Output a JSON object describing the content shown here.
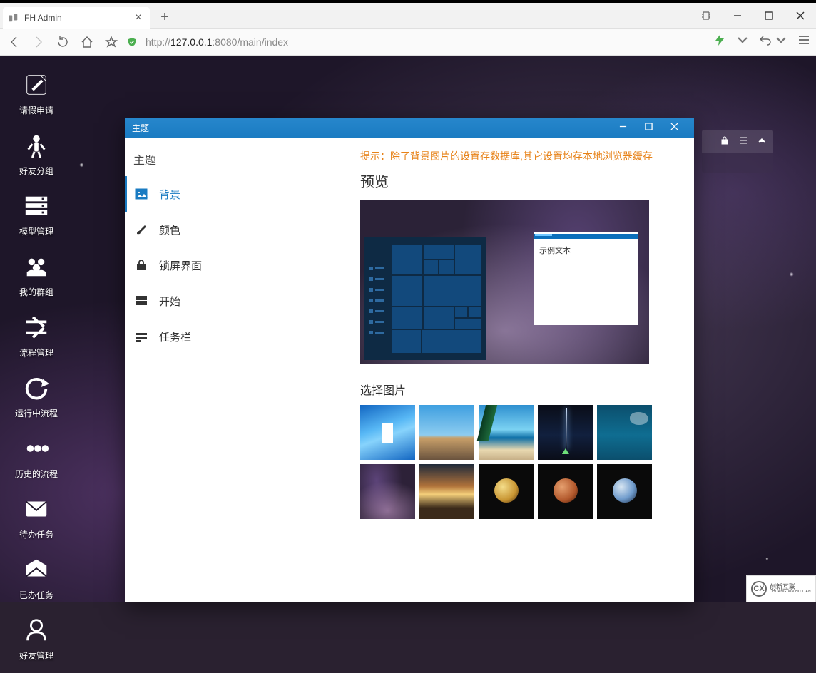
{
  "browser": {
    "tab_title": "FH Admin",
    "url_prefix": "http://",
    "url_host": "127.0.0.1",
    "url_port_path": ":8080/main/index"
  },
  "desktop_icons": [
    {
      "name": "leave-apply",
      "label": "请假申请"
    },
    {
      "name": "friend-group",
      "label": "好友分组"
    },
    {
      "name": "model-manage",
      "label": "模型管理"
    },
    {
      "name": "my-group",
      "label": "我的群组"
    },
    {
      "name": "flow-manage",
      "label": "流程管理"
    },
    {
      "name": "running-flow",
      "label": "运行中流程"
    },
    {
      "name": "history-flow",
      "label": "历史的流程"
    },
    {
      "name": "todo-task",
      "label": "待办任务"
    },
    {
      "name": "done-task",
      "label": "已办任务"
    },
    {
      "name": "friend-manage",
      "label": "好友管理"
    }
  ],
  "dialog": {
    "title": "主题",
    "side_heading": "主题",
    "side_items": [
      {
        "name": "background",
        "label": "背景",
        "active": true
      },
      {
        "name": "color",
        "label": "颜色"
      },
      {
        "name": "lockscreen",
        "label": "锁屏界面"
      },
      {
        "name": "start",
        "label": "开始"
      },
      {
        "name": "taskbar",
        "label": "任务栏"
      }
    ],
    "tip": "提示：除了背景图片的设置存数据库,其它设置均存本地浏览器缓存",
    "preview_heading": "预览",
    "example_text": "示例文本",
    "choose_heading": "选择图片"
  },
  "watermark": {
    "brand1": "创新互联",
    "brand2": "CHUANG XIN HU LIAN"
  }
}
